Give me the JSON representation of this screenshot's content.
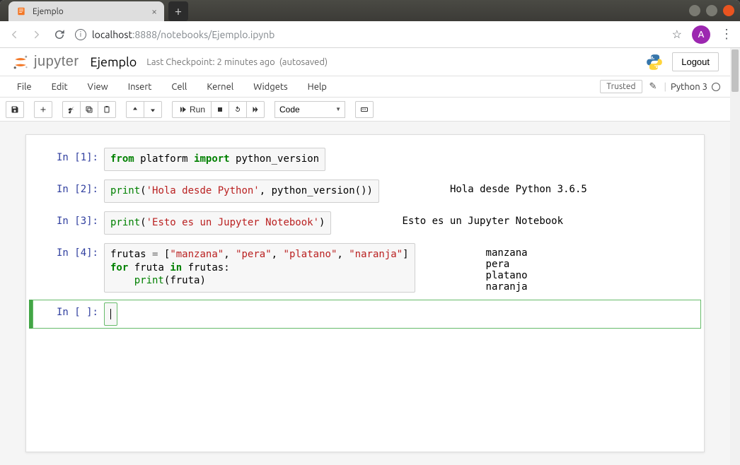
{
  "browser": {
    "tab_title": "Ejemplo",
    "url_display_host": "localhost",
    "url_display_rest": ":8888/notebooks/Ejemplo.ipynb",
    "avatar_letter": "A"
  },
  "header": {
    "logo_text": "jupyter",
    "notebook_name": "Ejemplo",
    "checkpoint": "Last Checkpoint: 2 minutes ago",
    "autosave": "(autosaved)",
    "logout": "Logout"
  },
  "menubar": {
    "items": [
      "File",
      "Edit",
      "View",
      "Insert",
      "Cell",
      "Kernel",
      "Widgets",
      "Help"
    ],
    "trusted": "Trusted",
    "kernel": "Python 3"
  },
  "toolbar": {
    "run_label": "Run",
    "cell_type": "Code"
  },
  "cells": [
    {
      "prompt": "In [1]:",
      "code_html": "<span class='kw'>from</span> <span class='nm'>platform</span> <span class='kw'>import</span> <span class='nm'>python_version</span>",
      "output": ""
    },
    {
      "prompt": "In [2]:",
      "code_html": "<span class='bn'>print</span><span class='pc'>(</span><span class='st'>'Hola desde Python'</span><span class='pc'>,</span> <span class='nm'>python_version</span><span class='pc'>())</span>",
      "output": "Hola desde Python 3.6.5"
    },
    {
      "prompt": "In [3]:",
      "code_html": "<span class='bn'>print</span><span class='pc'>(</span><span class='st'>'Esto es un Jupyter Notebook'</span><span class='pc'>)</span>",
      "output": "Esto es un Jupyter Notebook"
    },
    {
      "prompt": "In [4]:",
      "code_html": "<span class='nm'>frutas</span> <span class='op'>=</span> <span class='pc'>[</span><span class='st'>\"manzana\"</span><span class='pc'>,</span> <span class='st'>\"pera\"</span><span class='pc'>,</span> <span class='st'>\"platano\"</span><span class='pc'>,</span> <span class='st'>\"naranja\"</span><span class='pc'>]</span>\n<span class='kw'>for</span> <span class='nm'>fruta</span> <span class='kw'>in</span> <span class='nm'>frutas</span><span class='pc'>:</span>\n    <span class='bn'>print</span><span class='pc'>(</span><span class='nm'>fruta</span><span class='pc'>)</span>",
      "output": "manzana\npera\nplatano\nnaranja"
    },
    {
      "prompt": "In [ ]:",
      "code_html": "<span class='cursor'></span>",
      "output": "",
      "selected": true
    }
  ]
}
